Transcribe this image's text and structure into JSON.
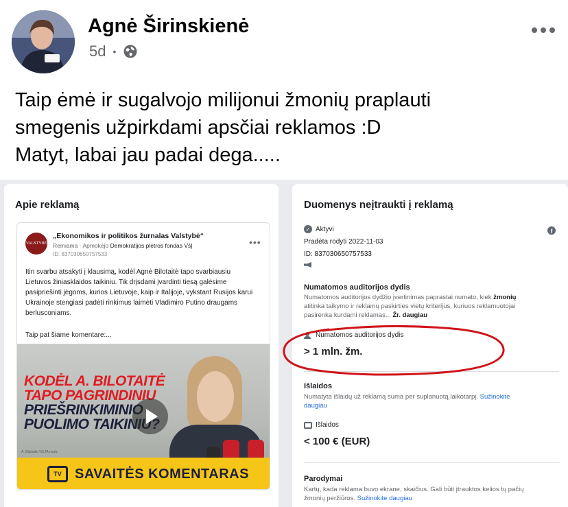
{
  "post": {
    "author": "Agnė Širinskienė",
    "time": "5d",
    "visibility_icon": "globe-icon",
    "text_lines": [
      "Taip ėmė ir sugalvojo milijonui žmonių praplauti",
      "smegenis užpirkdami apsčiai reklamos :D",
      "Matyt, labai jau padai dega....."
    ]
  },
  "left_panel": {
    "title": "Apie reklamą",
    "ad": {
      "page_name": "„Ekonomikos ir politikos žurnalas Valstybė“",
      "sponsor_prefix": "Remiama · Apmokėjo",
      "sponsor_name": "Demokratijos plėtros fondas VšĮ",
      "id": "ID: 837030650757533",
      "logo_text": "VALSTYBĖ",
      "body_lines": [
        "Itin svarbu atsakyti į klausimą, kodėl Agnė Bilotaitė tapo svarbiausiu",
        "Lietuvos žiniasklaidos taikiniu. Tik drįsdami įvardinti tiesą galėsime",
        "pasipriešinti jėgoms, kurios Lietuvoje, kaip ir Italijoje, vykstant Rusijos karui",
        "Ukrainoje stengiasi padėti rinkimus laimėti Vladimiro Putino draugams",
        "berlusconiams."
      ],
      "also_text": "Taip pat šiame komentare:...",
      "image_headline": [
        {
          "text": "KODĖL A. BILOTAITĖ",
          "color": "red"
        },
        {
          "text": "TAPO PAGRINDINIU",
          "color": "red"
        },
        {
          "text": "PRIEŠRINKIMINIO",
          "color": "dark"
        },
        {
          "text": "PUOLIMO TAIKINIU?",
          "color": "dark"
        }
      ],
      "tv_logo": "TV",
      "banner_text": "SAVAITĖS KOMENTARAS",
      "image_credit": "A. Bilotaitė / ELTA nuotr."
    }
  },
  "right_panel": {
    "title": "Duomenys neįtraukti į reklamą",
    "status": "Aktyvi",
    "started": "Pradėta rodyti 2022-11-03",
    "id": "ID: 837030650757533",
    "audience": {
      "title": "Numatomos auditorijos dydis",
      "desc_lines": [
        "Numatomos auditorijos dydžio įvertinimas paprastai numato, kiek",
        "atitinka taikymo ir reklamų paskirties vietų kriterijus, kuriuos reklamuotojai",
        "pasirenka kurdami reklamas..."
      ],
      "desc_bold": "žmonių",
      "more_link": "Žr. daugiau",
      "sub_label": "Numatomos auditorijos dydis",
      "value": "> 1 mln. žm."
    },
    "spend": {
      "title": "Išlaidos",
      "desc": "Numatyta išlaidų už reklamą suma per suplanuotą laikotarpį.",
      "link_1": "Sužinokite",
      "link_2": "daugiau",
      "sub_label": "Išlaidos",
      "value": "< 100 € (EUR)"
    },
    "impressions": {
      "title": "Parodymai",
      "desc_1": "Kartų, kada reklama buvo ekrane, skaičius. Gali būti įtrauktos kelios tų pačių",
      "desc_2": "žmonių peržiūros.",
      "link": "Sužinokite daugiau"
    }
  },
  "colors": {
    "annotation": "#d0141b",
    "link": "#216fdb",
    "banner": "#f5c518"
  }
}
